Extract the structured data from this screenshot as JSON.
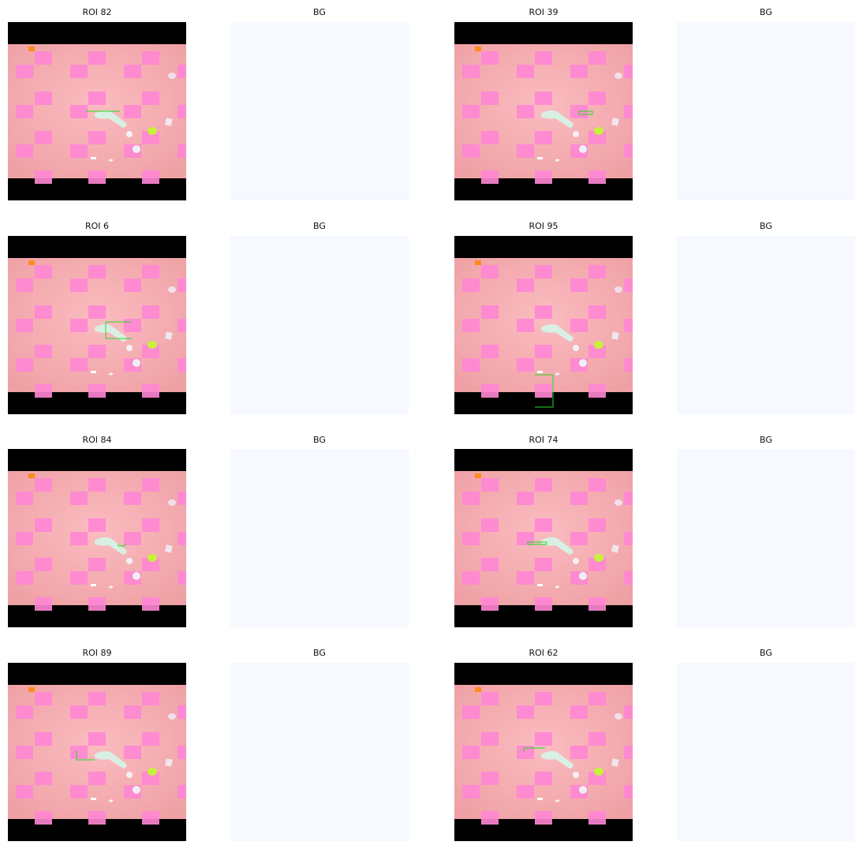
{
  "rows": [
    {
      "roi_label": "ROI 82",
      "bg_label": "BG"
    },
    {
      "roi_label": "ROI 39",
      "bg_label": "BG"
    },
    {
      "roi_label": "ROI 6",
      "bg_label": "BG"
    },
    {
      "roi_label": "ROI 95",
      "bg_label": "BG"
    },
    {
      "roi_label": "ROI 84",
      "bg_label": "BG"
    },
    {
      "roi_label": "ROI 74",
      "bg_label": "BG"
    },
    {
      "roi_label": "ROI 89",
      "bg_label": "BG"
    },
    {
      "roi_label": "ROI 62",
      "bg_label": "BG"
    }
  ],
  "colors": {
    "letterbox": "#000000",
    "floor_light": "#fbbcc0",
    "floor_edge": "#eea0a4",
    "checker": "#ff86d4",
    "roi_box": "#22dd22",
    "bg_panel": "#f6f9ff"
  }
}
